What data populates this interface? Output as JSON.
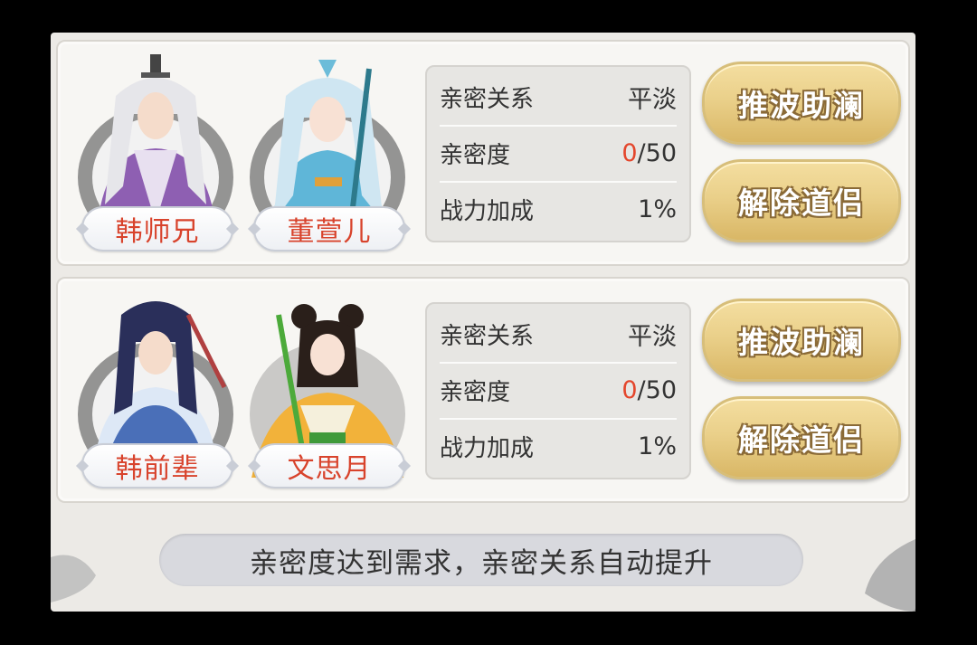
{
  "pairs": [
    {
      "male": {
        "name": "韩师兄",
        "robe_color": "#8e5fb2"
      },
      "female": {
        "name": "董萱儿",
        "robe_color": "#5fb6d8"
      },
      "stats": [
        {
          "label": "亲密关系",
          "value": "平淡"
        },
        {
          "label": "亲密度",
          "current": "0",
          "max": "/50"
        },
        {
          "label": "战力加成",
          "value": "1%"
        }
      ],
      "buttons": {
        "boost": "推波助澜",
        "dissolve": "解除道侣"
      }
    },
    {
      "male": {
        "name": "韩前辈",
        "robe_color": "#4a6fb8"
      },
      "female": {
        "name": "文思月",
        "robe_color": "#f2b23a"
      },
      "stats": [
        {
          "label": "亲密关系",
          "value": "平淡"
        },
        {
          "label": "亲密度",
          "current": "0",
          "max": "/50"
        },
        {
          "label": "战力加成",
          "value": "1%"
        }
      ],
      "buttons": {
        "boost": "推波助澜",
        "dissolve": "解除道侣"
      }
    }
  ],
  "tip": "亲密度达到需求，亲密关系自动提升",
  "colors": {
    "accent_red": "#e4462c",
    "button_gold": "#ead08a"
  }
}
